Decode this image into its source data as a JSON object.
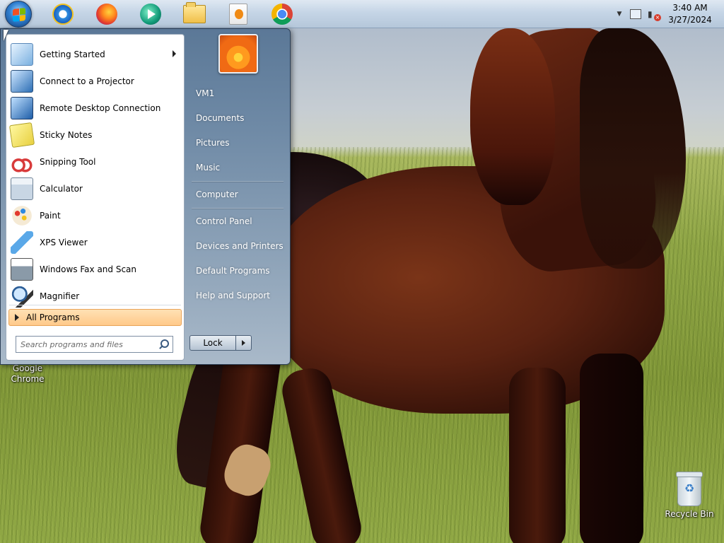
{
  "taskbar": {
    "apps": [
      {
        "name": "Internet Explorer",
        "icon": "internet-explorer-icon"
      },
      {
        "name": "Firefox",
        "icon": "firefox-icon"
      },
      {
        "name": "Media Player",
        "icon": "media-player-icon"
      },
      {
        "name": "File Explorer",
        "icon": "folder-icon"
      },
      {
        "name": "Media Center",
        "icon": "media-file-icon"
      },
      {
        "name": "Google Chrome",
        "icon": "chrome-icon"
      }
    ],
    "clock": {
      "time": "3:40 AM",
      "date": "3/27/2024"
    }
  },
  "start_menu": {
    "programs": [
      {
        "label": "Getting Started",
        "icon": "getting-started-icon",
        "has_submenu": true
      },
      {
        "label": "Connect to a Projector",
        "icon": "projector-icon"
      },
      {
        "label": "Remote Desktop Connection",
        "icon": "remote-desktop-icon"
      },
      {
        "label": "Sticky Notes",
        "icon": "sticky-notes-icon"
      },
      {
        "label": "Snipping Tool",
        "icon": "scissors-icon"
      },
      {
        "label": "Calculator",
        "icon": "calculator-icon"
      },
      {
        "label": "Paint",
        "icon": "paint-palette-icon"
      },
      {
        "label": "XPS Viewer",
        "icon": "xps-viewer-icon"
      },
      {
        "label": "Windows Fax and Scan",
        "icon": "fax-icon"
      },
      {
        "label": "Magnifier",
        "icon": "magnifier-icon"
      }
    ],
    "all_programs_label": "All Programs",
    "search_placeholder": "Search programs and files",
    "right_items": [
      {
        "label": "VM1"
      },
      {
        "label": "Documents"
      },
      {
        "label": "Pictures"
      },
      {
        "label": "Music"
      },
      {
        "label": "Computer"
      },
      {
        "label": "Control Panel"
      },
      {
        "label": "Devices and Printers"
      },
      {
        "label": "Default Programs"
      },
      {
        "label": "Help and Support"
      }
    ],
    "lock_label": "Lock"
  },
  "desktop": {
    "icons": [
      {
        "label": "Google Chrome"
      },
      {
        "label": "Recycle Bin"
      }
    ]
  },
  "colors": {
    "all_programs_highlight": "#ffc98a",
    "start_menu_frame": "#6f8aa6"
  }
}
